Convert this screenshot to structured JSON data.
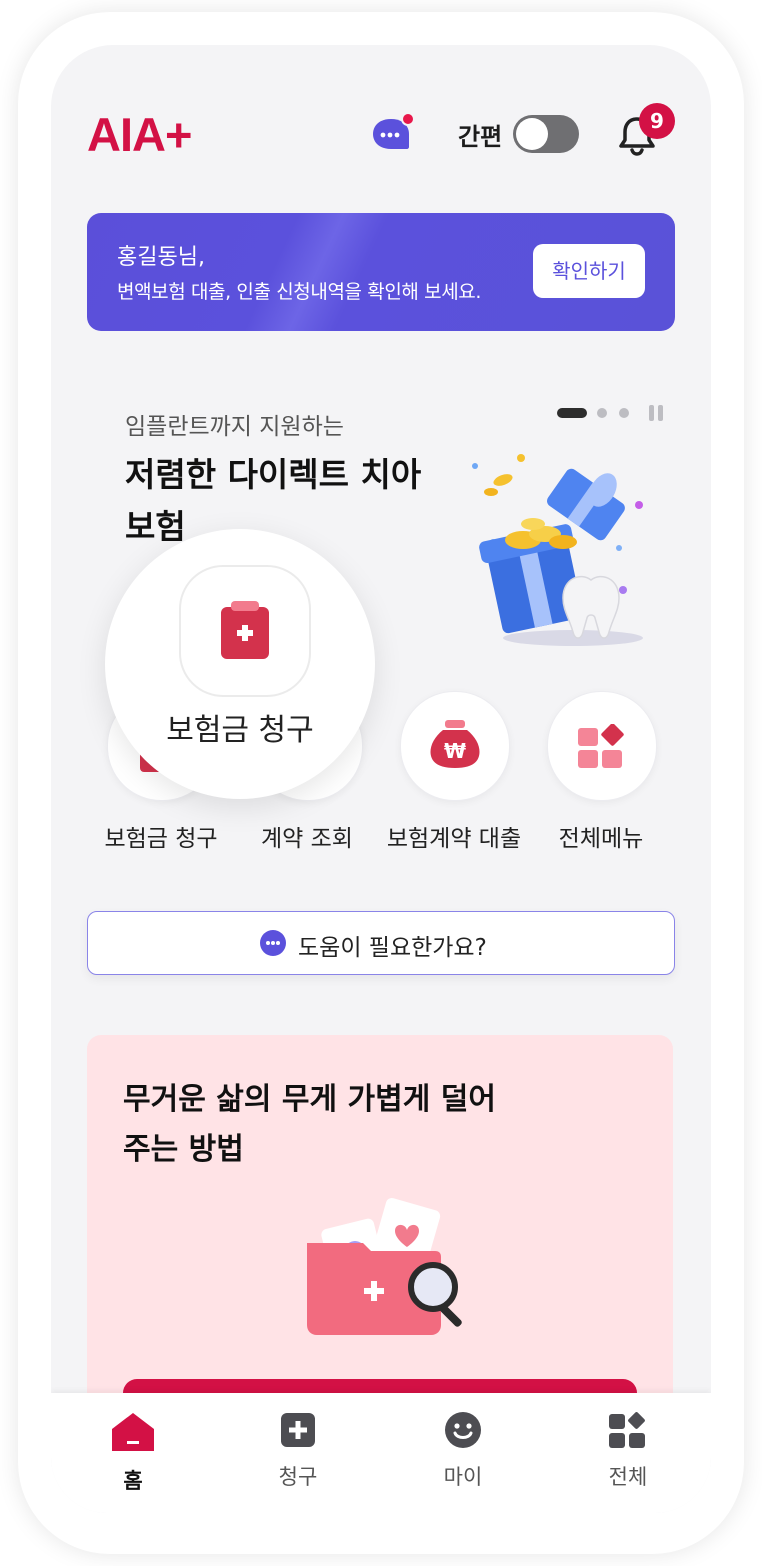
{
  "header": {
    "logo": "AIA+",
    "simple_mode_label": "간편",
    "notification_count": "9",
    "simple_mode_on": false
  },
  "banner": {
    "greeting": "홍길동님,",
    "message": "변액보험 대출, 인출 신청내역을 확인해 보세요.",
    "button": "확인하기"
  },
  "promo": {
    "subtitle": "임플란트까지 지원하는",
    "title": "저렴한 다이렉트 치아보험",
    "carousel_index": 1,
    "carousel_total": 3
  },
  "zoom": {
    "label": "보험금 청구"
  },
  "quick_menu": [
    {
      "label": "보험금 청구",
      "icon": "claim-clipboard-icon"
    },
    {
      "label": "계약 조회",
      "icon": "contract-icon"
    },
    {
      "label": "보험계약 대출",
      "icon": "money-bag-icon"
    },
    {
      "label": "전체메뉴",
      "icon": "grid-menu-icon"
    }
  ],
  "help": {
    "label": "도움이 필요한가요?"
  },
  "card": {
    "title": "무거운 삶의 무게 가볍게 덜어주는 방법"
  },
  "bottom_nav": [
    {
      "label": "홈",
      "icon": "home-icon",
      "active": true
    },
    {
      "label": "청구",
      "icon": "claim-plus-icon",
      "active": false
    },
    {
      "label": "마이",
      "icon": "smile-face-icon",
      "active": false
    },
    {
      "label": "전체",
      "icon": "grid-icon",
      "active": false
    }
  ],
  "colors": {
    "brand": "#d31145",
    "banner": "#5b51dc",
    "card_bg": "#ffe3e6"
  }
}
